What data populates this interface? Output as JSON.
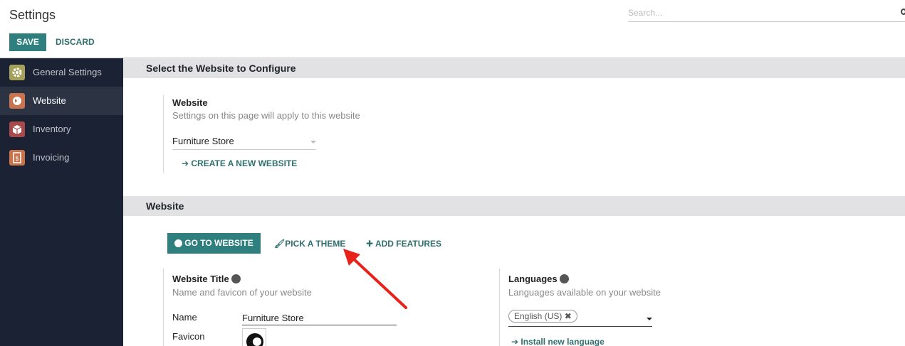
{
  "control_panel": {
    "title": "Settings",
    "search_placeholder": "Search...",
    "save_label": "SAVE",
    "discard_label": "DISCARD"
  },
  "sidebar": {
    "items": [
      {
        "label": "General Settings",
        "icon": "gear-icon",
        "icon_color": "#a5a05a"
      },
      {
        "label": "Website",
        "icon": "globe-icon",
        "icon_color": "#c9734f"
      },
      {
        "label": "Inventory",
        "icon": "box-icon",
        "icon_color": "#a94a4a"
      },
      {
        "label": "Invoicing",
        "icon": "invoice-icon",
        "icon_color": "#c8744a"
      }
    ],
    "active_index": 1
  },
  "select_website": {
    "section_title": "Select the Website to Configure",
    "field_title": "Website",
    "field_desc": "Settings on this page will apply to this website",
    "selected_value": "Furniture Store",
    "create_link": "CREATE A NEW WEBSITE"
  },
  "website": {
    "section_title": "Website",
    "go_to_website": "GO TO WEBSITE",
    "pick_theme": "PICK A THEME",
    "add_features": "ADD FEATURES",
    "title_block": {
      "title": "Website Title",
      "desc": "Name and favicon of your website",
      "name_label": "Name",
      "name_value": "Furniture Store",
      "favicon_label": "Favicon"
    },
    "languages_block": {
      "title": "Languages",
      "desc": "Languages available on your website",
      "tag": "English (US)",
      "install_link": "Install new language"
    }
  },
  "colors": {
    "primary": "#2f7f7e",
    "sidebar_bg": "#1a2233",
    "annotation_arrow": "#e8221b"
  }
}
